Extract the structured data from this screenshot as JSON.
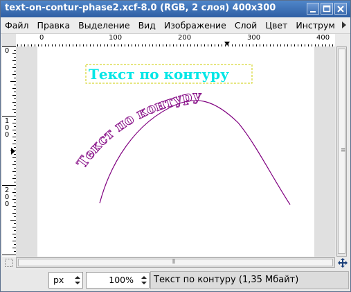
{
  "window": {
    "title": "text-on-contur-phase2.xcf-8.0 (RGB, 2 слоя) 400x300"
  },
  "menu": {
    "items": [
      "Файл",
      "Правка",
      "Выделение",
      "Вид",
      "Изображение",
      "Слой",
      "Цвет",
      "Инструм"
    ]
  },
  "rulers": {
    "horizontal": [
      "0",
      "100",
      "200",
      "300",
      "400"
    ],
    "vertical": [
      "0",
      "100",
      "200"
    ]
  },
  "canvas": {
    "text_box": "Текст по контуру",
    "curved_text": "Текст по контуру",
    "text_color": "#00e6e6",
    "path_color": "#800080"
  },
  "status": {
    "unit": "px",
    "zoom": "100%",
    "message": "Текст по контуру (1,35 Мбайт)"
  },
  "icons": {
    "minimize": "minimize-icon",
    "maximize": "maximize-icon",
    "close": "close-icon",
    "navigate": "navigate-icon",
    "quickmask": "quick-mask-icon",
    "menu-arrow": "menu-arrow-icon"
  }
}
